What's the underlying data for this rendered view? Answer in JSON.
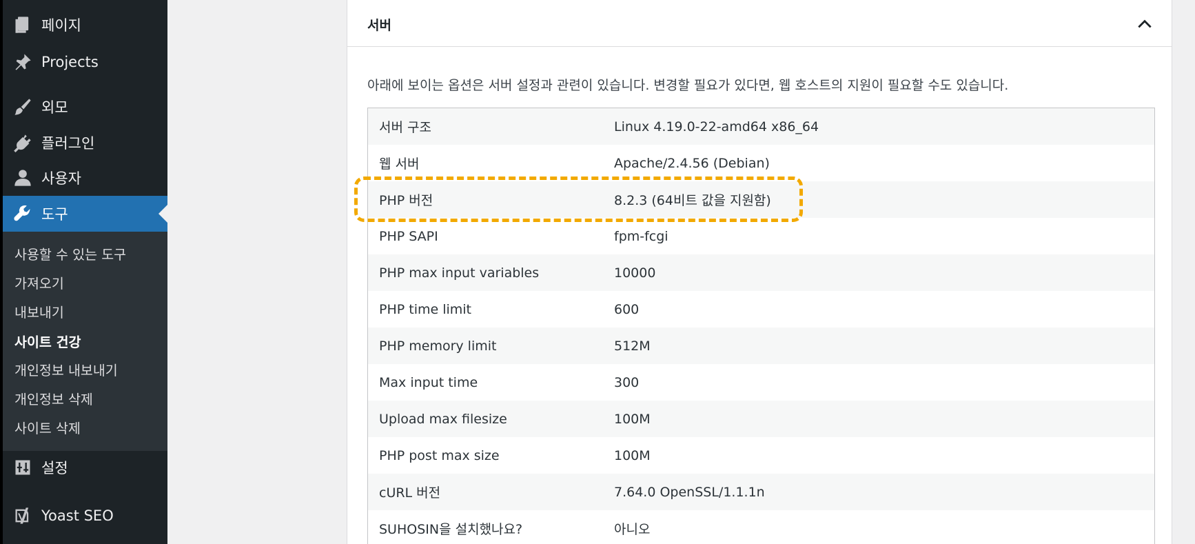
{
  "sidebar": {
    "menu": [
      {
        "label": "페이지",
        "icon": "pages-icon"
      },
      {
        "label": "Projects",
        "icon": "pin-icon"
      },
      {
        "label": "외모",
        "icon": "brush-icon"
      },
      {
        "label": "플러그인",
        "icon": "plugin-icon"
      },
      {
        "label": "사용자",
        "icon": "user-icon"
      },
      {
        "label": "도구",
        "icon": "wrench-icon"
      },
      {
        "label": "설정",
        "icon": "settings-icon"
      },
      {
        "label": "Yoast SEO",
        "icon": "yoast-icon"
      }
    ],
    "submenu": [
      "사용할 수 있는 도구",
      "가져오기",
      "내보내기",
      "사이트 건강",
      "개인정보 내보내기",
      "개인정보 삭제",
      "사이트 삭제"
    ]
  },
  "section": {
    "title": "서버",
    "description": "아래에 보이는 옵션은 서버 설정과 관련이 있습니다. 변경할 필요가 있다면, 웹 호스트의 지원이 필요할 수도 있습니다.",
    "rows": [
      {
        "label": "서버 구조",
        "value": "Linux 4.19.0-22-amd64 x86_64"
      },
      {
        "label": "웹 서버",
        "value": "Apache/2.4.56 (Debian)"
      },
      {
        "label": "PHP 버전",
        "value": "8.2.3 (64비트 값을 지원함)"
      },
      {
        "label": "PHP SAPI",
        "value": "fpm-fcgi"
      },
      {
        "label": "PHP max input variables",
        "value": "10000"
      },
      {
        "label": "PHP time limit",
        "value": "600"
      },
      {
        "label": "PHP memory limit",
        "value": "512M"
      },
      {
        "label": "Max input time",
        "value": "300"
      },
      {
        "label": "Upload max filesize",
        "value": "100M"
      },
      {
        "label": "PHP post max size",
        "value": "100M"
      },
      {
        "label": "cURL 버전",
        "value": "7.64.0 OpenSSL/1.1.1n"
      },
      {
        "label": "SUHOSIN을 설치했나요?",
        "value": "아니오"
      }
    ]
  },
  "colors": {
    "sidebar_bg": "#1d2327",
    "active_menu": "#2271b1",
    "highlight": "#f2a900"
  }
}
